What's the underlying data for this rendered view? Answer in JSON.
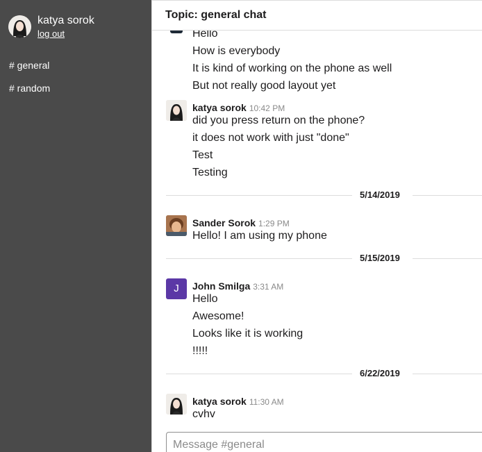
{
  "sidebar": {
    "user_name": "katya sorok",
    "logout_label": "log out",
    "channels": [
      {
        "label": "# general"
      },
      {
        "label": "# random"
      }
    ]
  },
  "header": {
    "title": "Topic: general chat"
  },
  "messages": {
    "prev_lines": [
      "Hello",
      "How is everybody",
      "It is kind of working on the phone as well",
      "But not really good layout yet"
    ],
    "m1": {
      "author": "katya sorok",
      "time": "10:42 PM",
      "lines": [
        "did you press return on the phone?",
        "it does not work with just \"done\"",
        "Test",
        "Testing"
      ]
    },
    "d1": "5/14/2019",
    "m2": {
      "author": "Sander Sorok",
      "time": "1:29 PM",
      "lines": [
        "Hello! I am using my phone"
      ]
    },
    "d2": "5/15/2019",
    "m3": {
      "author": "John Smilga",
      "time": "3:31 AM",
      "avatar_letter": "J",
      "avatar_color": "#5b38a6",
      "lines": [
        "Hello",
        "Awesome!",
        "Looks like it is working",
        "!!!!!"
      ]
    },
    "d3": "6/22/2019",
    "m4": {
      "author": "katya sorok",
      "time": "11:30 AM",
      "lines": [
        "cvhv"
      ]
    }
  },
  "composer": {
    "placeholder": "Message #general"
  },
  "colors": {
    "sidebar_bg": "#4a4a4a",
    "avatar_j": "#5b38a6"
  }
}
